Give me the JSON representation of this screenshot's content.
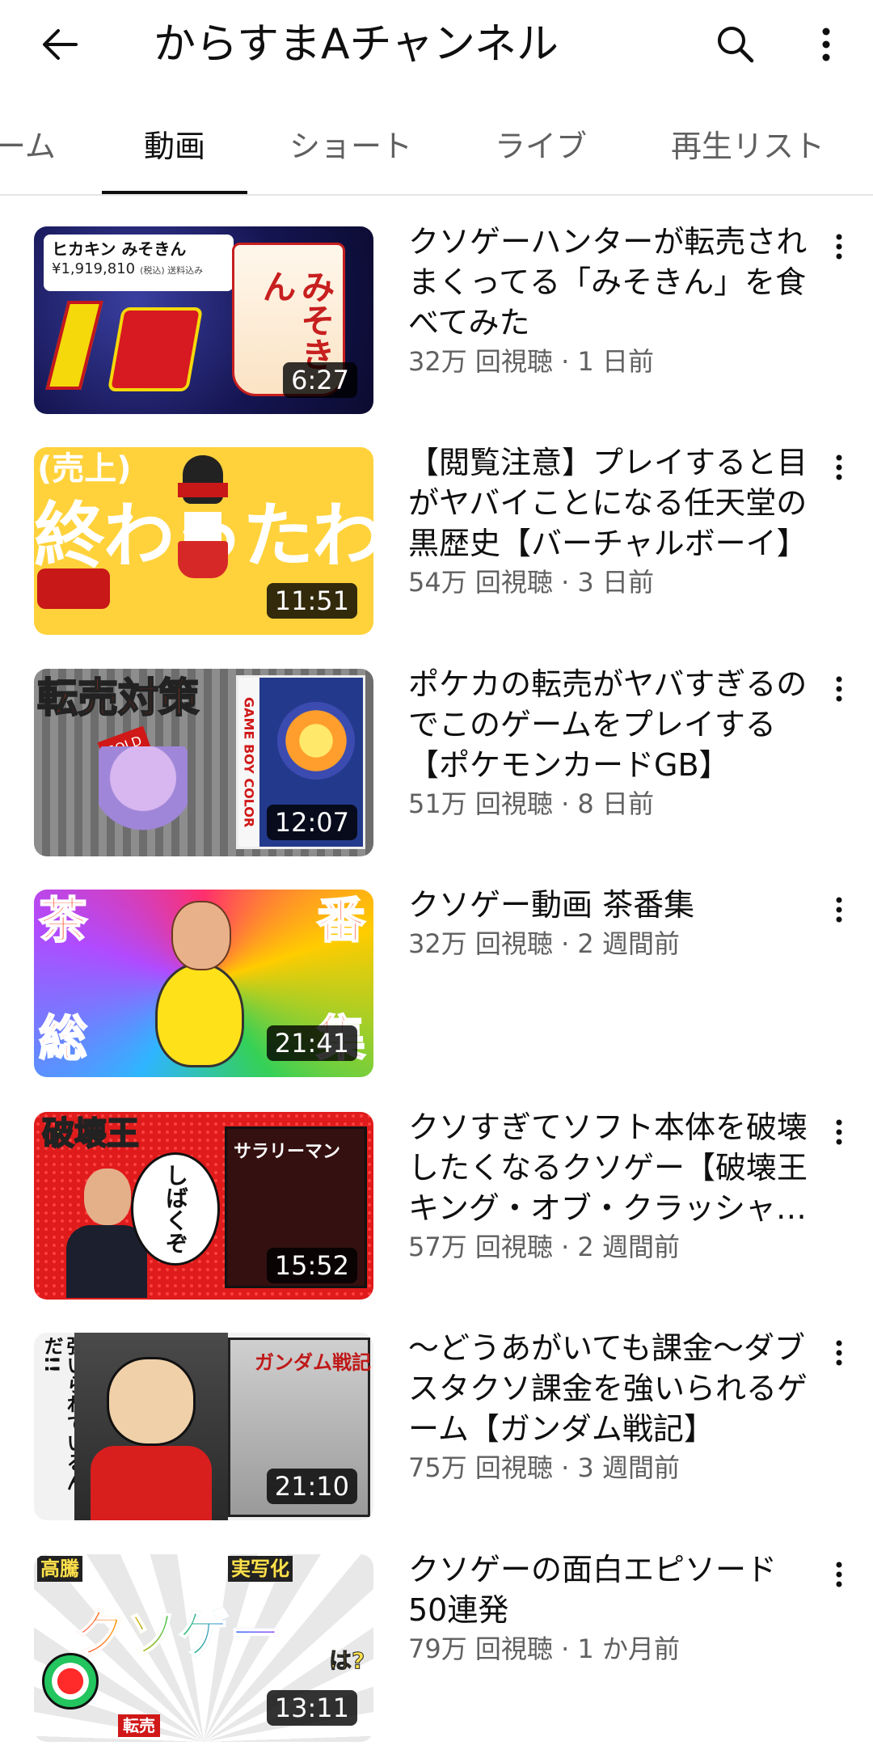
{
  "header": {
    "title": "からすまAチャンネル",
    "icons": {
      "back": "arrow-back-icon",
      "search": "search-icon",
      "more": "more-vert-icon"
    }
  },
  "tabs": [
    {
      "label": "ーム",
      "active": false
    },
    {
      "label": "動画",
      "active": true
    },
    {
      "label": "ショート",
      "active": false
    },
    {
      "label": "ライブ",
      "active": false
    },
    {
      "label": "再生リスト",
      "active": false
    }
  ],
  "videos": [
    {
      "title": "クソゲーハンターが転売されまくってる「みそきん」を食べてみた",
      "meta": "32万 回視聴 · 1 日前",
      "duration": "6:27",
      "thumb_text": [
        "ヒカキン みそきん",
        "¥1,919,810",
        "(税込) 送料込み",
        "みそきん"
      ]
    },
    {
      "title": "【閲覧注意】プレイすると目がヤバイことになる任天堂の黒歴史【バーチャルボーイ】",
      "meta": "54万 回視聴 · 3 日前",
      "duration": "11:51",
      "thumb_text": [
        "(売上)",
        "終わったわ"
      ]
    },
    {
      "title": "ポケカの転売がヤバすぎるのでこのゲームをプレイする【ポケモンカードGB】",
      "meta": "51万 回視聴 · 8 日前",
      "duration": "12:07",
      "thumb_text": [
        "転売対策",
        "SOLD",
        "GAME BOY COLOR"
      ]
    },
    {
      "title": "クソゲー動画 茶番集",
      "meta": "32万 回視聴 · 2 週間前",
      "duration": "21:41",
      "thumb_text": [
        "茶",
        "番",
        "総",
        "集"
      ]
    },
    {
      "title": "クソすぎてソフト本体を破壊したくなるクソゲー【破壊王 キング・オブ・クラッシャー】",
      "meta": "57万 回視聴 · 2 週間前",
      "duration": "15:52",
      "thumb_text": [
        "破壊王",
        "しばくぞ",
        "サラリーマン"
      ]
    },
    {
      "title": "～どうあがいても課金～ダブスタクソ課金を強いられるゲーム【ガンダム戦記】",
      "meta": "75万 回視聴 · 3 週間前",
      "duration": "21:10",
      "thumb_text": [
        "強いられているんだ!!",
        "ガンダム戦記"
      ]
    },
    {
      "title": "クソゲーの面白エピソード50連発",
      "meta": "79万 回視聴 · 1 か月前",
      "duration": "13:11",
      "thumb_text": [
        "高騰",
        "実写化",
        "クソゲー",
        "は?",
        "転売"
      ]
    }
  ],
  "colors": {
    "text_primary": "#0f0f0f",
    "text_secondary": "#606060",
    "divider": "#e5e5e5"
  }
}
